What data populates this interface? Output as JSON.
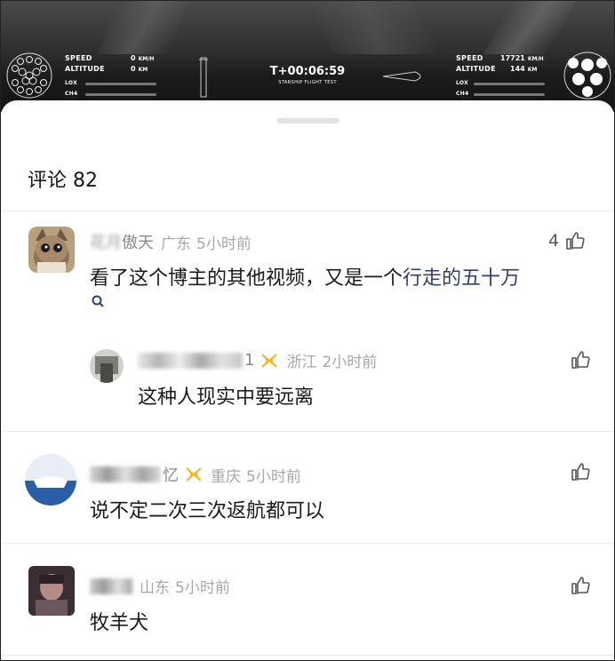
{
  "video": {
    "left": {
      "speed_label": "SPEED",
      "speed_value": "0",
      "speed_unit": "KM/H",
      "altitude_label": "ALTITUDE",
      "altitude_value": "0",
      "altitude_unit": "KM",
      "lox_label": "LOX",
      "ch4_label": "CH4"
    },
    "clock": "T+00:06:59",
    "caption": "STARSHIP FLIGHT TEST",
    "right": {
      "speed_label": "SPEED",
      "speed_value": "17721",
      "speed_unit": "KM/H",
      "altitude_label": "ALTITUDE",
      "altitude_value": "144",
      "altitude_unit": "KM",
      "lox_label": "LOX",
      "ch4_label": "CH4"
    }
  },
  "comments_header": {
    "label": "评论 82"
  },
  "comments": [
    {
      "name_blurred": "花月",
      "name_visible": "傲天",
      "location": "广东",
      "time": "5小时前",
      "likes": "4",
      "text_plain": "看了这个博主的其他视频，又是一个",
      "text_link": "行走的五十万"
    },
    {
      "name_blurred": "",
      "name_visible": "1",
      "location": "浙江",
      "time": "2小时前",
      "text": "这种人现实中要远离"
    },
    {
      "name_blurred": "",
      "name_visible": "忆",
      "location": "重庆",
      "time": "5小时前",
      "text": "说不定二次三次返航都可以"
    },
    {
      "name_blurred": "",
      "name_visible": "",
      "location": "山东",
      "time": "5小时前",
      "text": "牧羊犬"
    }
  ],
  "icons": {
    "like": "thumbs-up-icon",
    "search": "search-icon",
    "vip": "vip-badge-icon"
  }
}
